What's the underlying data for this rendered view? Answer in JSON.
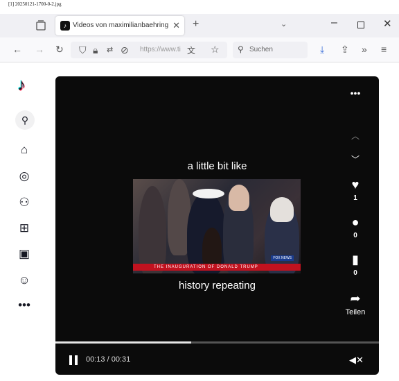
{
  "caption": "[1] 20250121-1700-0-2.jpg",
  "browser": {
    "tab_title": "Videos von maximilianbaehring",
    "new_tab_glyph": "+",
    "url": "https://www.ti",
    "search_placeholder": "Suchen"
  },
  "tiktok_sidebar": {
    "items": [
      "search",
      "home",
      "explore",
      "following",
      "upload",
      "live",
      "profile",
      "more"
    ]
  },
  "video": {
    "subtitle_top": "a little bit like",
    "subtitle_bottom": "history repeating",
    "news_banner": "THE INAUGURATION OF DONALD TRUMP",
    "news_logo": "FOX NEWS",
    "time": "00:13 / 00:31",
    "progress": 0.42,
    "likes": "1",
    "comments": "0",
    "saves": "0",
    "share_label": "Teilen"
  },
  "colors": {
    "accent": "#fe2c55",
    "accent2": "#25f4ee",
    "video_bg": "#0b0b0b"
  }
}
